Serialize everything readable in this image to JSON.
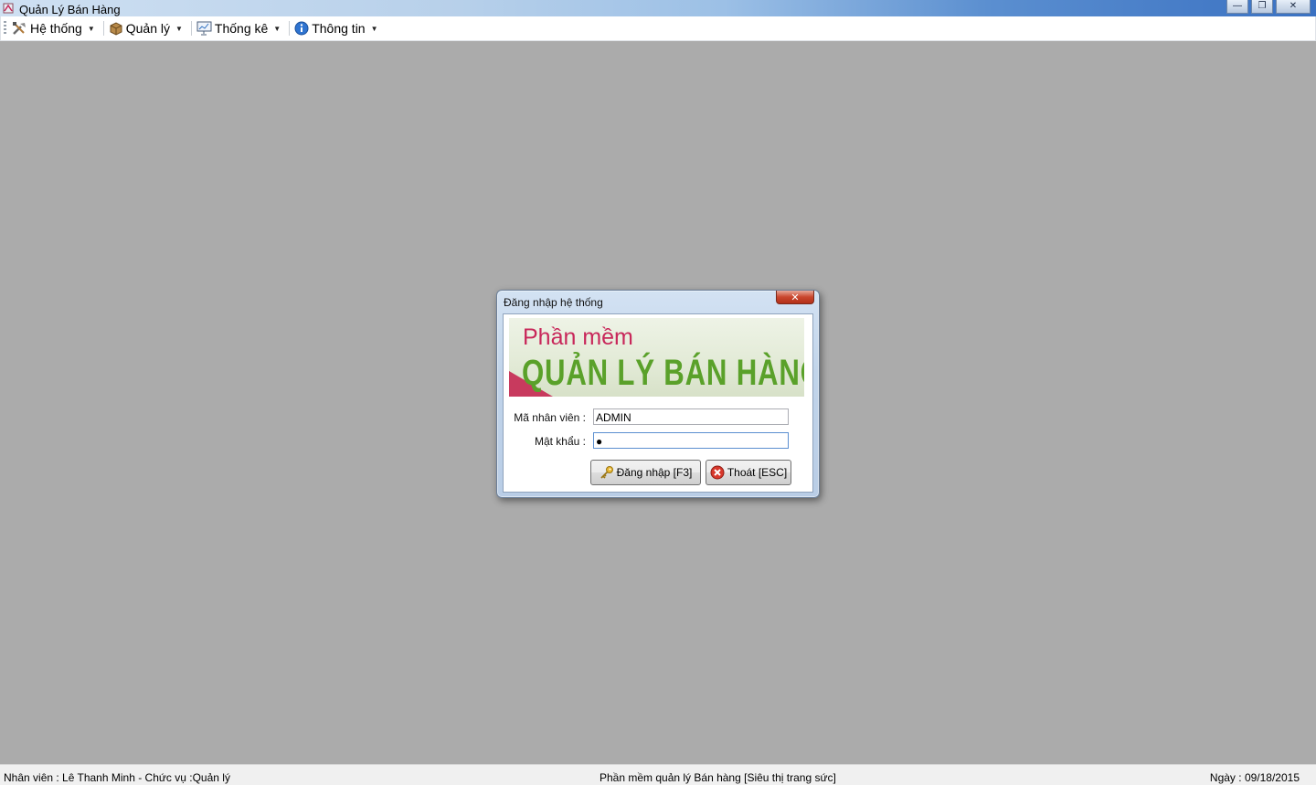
{
  "window": {
    "title": "Quản Lý Bán Hàng",
    "minimize_glyph": "—",
    "maximize_glyph": "❐",
    "close_glyph": "✕"
  },
  "menu": {
    "items": [
      {
        "label": "Hệ thống",
        "icon": "tools-icon"
      },
      {
        "label": "Quản lý",
        "icon": "box-icon"
      },
      {
        "label": "Thống kê",
        "icon": "presentation-icon"
      },
      {
        "label": "Thông tin",
        "icon": "info-icon"
      }
    ]
  },
  "login_dialog": {
    "title": "Đăng nhập hệ thống",
    "close_glyph": "✕",
    "banner": {
      "line1": "Phần mềm",
      "line2": "QUẢN LÝ BÁN HÀNG"
    },
    "employee_label": "Mã nhân viên :",
    "employee_value": "ADMIN",
    "password_label": "Mật khẩu :",
    "password_value": "●",
    "login_button": "Đăng nhập [F3]",
    "login_icon": "key-icon",
    "exit_button": "Thoát [ESC]",
    "exit_icon": "cancel-icon"
  },
  "status": {
    "employee": "Nhân viên : Lê Thanh Minh - Chức vụ :Quản lý",
    "software": "Phần mềm quản lý Bán hàng [Siêu thị trang sức]",
    "date": "Ngày : 09/18/2015"
  }
}
